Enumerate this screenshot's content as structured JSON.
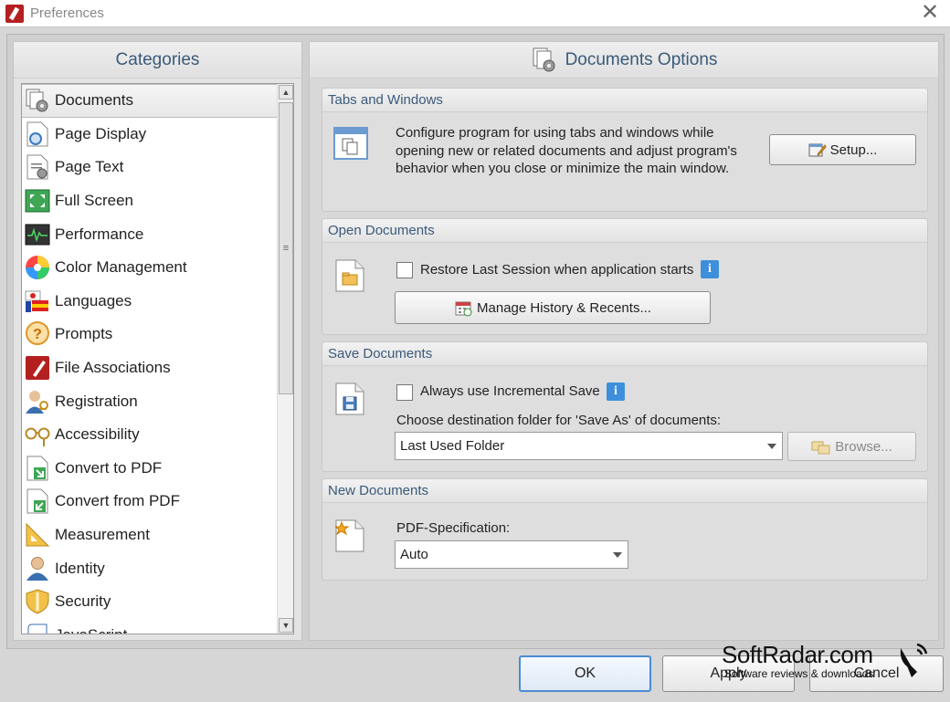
{
  "window": {
    "title": "Preferences",
    "close_glyph": "✕"
  },
  "categories": {
    "header": "Categories",
    "items": [
      {
        "label": "Documents",
        "icon": "documents-gear-icon",
        "selected": true
      },
      {
        "label": "Page Display",
        "icon": "page-display-icon"
      },
      {
        "label": "Page Text",
        "icon": "page-text-icon"
      },
      {
        "label": "Full Screen",
        "icon": "full-screen-icon"
      },
      {
        "label": "Performance",
        "icon": "performance-icon"
      },
      {
        "label": "Color Management",
        "icon": "color-wheel-icon"
      },
      {
        "label": "Languages",
        "icon": "flags-icon"
      },
      {
        "label": "Prompts",
        "icon": "question-bubble-icon"
      },
      {
        "label": "File Associations",
        "icon": "file-associations-icon"
      },
      {
        "label": "Registration",
        "icon": "user-key-icon"
      },
      {
        "label": "Accessibility",
        "icon": "glasses-icon"
      },
      {
        "label": "Convert to PDF",
        "icon": "convert-to-pdf-icon"
      },
      {
        "label": "Convert from PDF",
        "icon": "convert-from-pdf-icon"
      },
      {
        "label": "Measurement",
        "icon": "ruler-triangle-icon"
      },
      {
        "label": "Identity",
        "icon": "identity-person-icon"
      },
      {
        "label": "Security",
        "icon": "shield-icon"
      },
      {
        "label": "JavaScript",
        "icon": "javascript-scroll-icon"
      }
    ]
  },
  "options": {
    "header": "Documents Options",
    "tabs_windows": {
      "title": "Tabs and Windows",
      "description": "Configure program for using tabs and windows while opening new or related documents and adjust program's behavior when you close or minimize the main window.",
      "setup_button": "Setup..."
    },
    "open_documents": {
      "title": "Open Documents",
      "restore_label": "Restore Last Session when application starts",
      "restore_checked": false,
      "manage_button": "Manage History & Recents..."
    },
    "save_documents": {
      "title": "Save Documents",
      "incremental_label": "Always use Incremental Save",
      "incremental_checked": false,
      "dest_label": "Choose destination folder for 'Save As' of documents:",
      "dest_value": "Last Used Folder",
      "browse_button": "Browse..."
    },
    "new_documents": {
      "title": "New Documents",
      "spec_label": "PDF-Specification:",
      "spec_value": "Auto"
    }
  },
  "footer": {
    "ok": "OK",
    "apply": "Apply",
    "cancel": "Cancel"
  },
  "watermark": {
    "brand": "SoftRadar.com",
    "tagline": "Software reviews & downloads"
  },
  "colors": {
    "accent_text": "#3a5a7a",
    "info_blue": "#3e8fdb",
    "ok_border": "#4a8bd4"
  }
}
